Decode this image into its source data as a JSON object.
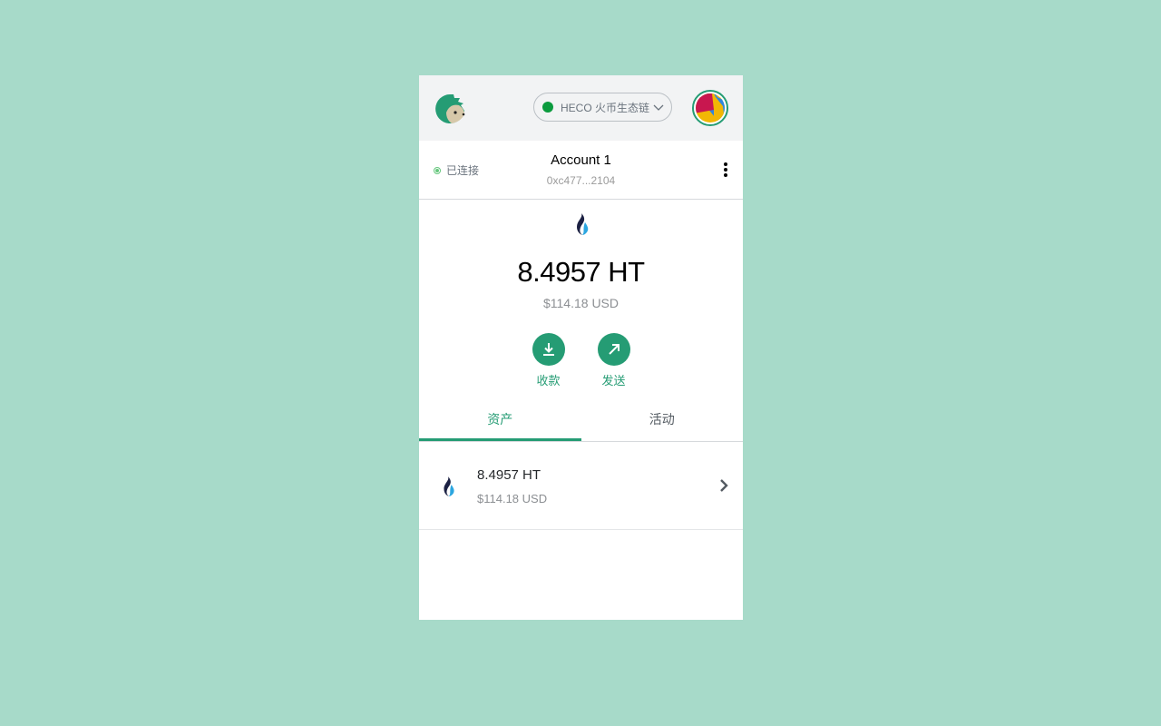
{
  "header": {
    "logo_icon": "hedgehog-logo-icon",
    "network": {
      "label": "HECO 火币生态链",
      "status_color": "#0c9b3e"
    },
    "avatar_icon": "account-avatar-identicon"
  },
  "account_bar": {
    "connection_status": "已连接",
    "account_name": "Account 1",
    "account_address": "0xc477...2104"
  },
  "balance": {
    "token_icon": "huobi-token-icon",
    "amount": "8.4957 HT",
    "fiat": "$114.18 USD",
    "actions": [
      {
        "label": "收款",
        "icon": "download-icon"
      },
      {
        "label": "发送",
        "icon": "arrow-up-right-icon"
      }
    ]
  },
  "tabs": [
    {
      "label": "资产",
      "active": true
    },
    {
      "label": "活动",
      "active": false
    }
  ],
  "assets": [
    {
      "amount": "8.4957 HT",
      "fiat": "$114.18 USD"
    }
  ],
  "colors": {
    "accent": "#259c74",
    "background": "#a7dac9"
  }
}
